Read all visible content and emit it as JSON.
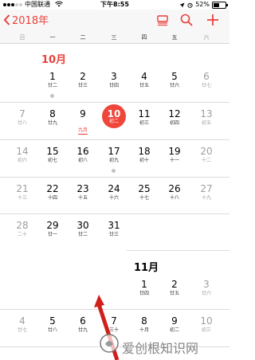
{
  "status_bar": {
    "carrier": "中国联通",
    "time": "下午8:55",
    "battery": "52%",
    "battery_level": 0.52
  },
  "nav": {
    "back_label": "2018年",
    "icons": [
      "chevron-left-icon",
      "list-view-icon",
      "search-icon",
      "add-icon"
    ]
  },
  "weekdays": [
    "日",
    "一",
    "二",
    "三",
    "四",
    "五",
    "六"
  ],
  "months": {
    "oct_label": "10月",
    "nov_label": "11月"
  },
  "october": [
    {
      "day": "1",
      "lunar": "廿二",
      "dot": true
    },
    {
      "day": "2",
      "lunar": "廿三"
    },
    {
      "day": "3",
      "lunar": "廿四"
    },
    {
      "day": "4",
      "lunar": "廿五"
    },
    {
      "day": "5",
      "lunar": "廿六"
    },
    {
      "day": "6",
      "lunar": "廿七"
    },
    {
      "day": "7",
      "lunar": "廿八"
    },
    {
      "day": "8",
      "lunar": "廿九"
    },
    {
      "day": "9",
      "lunar": "九月"
    },
    {
      "day": "10",
      "lunar": "初二",
      "today": true
    },
    {
      "day": "11",
      "lunar": "初三"
    },
    {
      "day": "12",
      "lunar": "初四"
    },
    {
      "day": "13",
      "lunar": "初五"
    },
    {
      "day": "14",
      "lunar": "初六"
    },
    {
      "day": "15",
      "lunar": "初七"
    },
    {
      "day": "16",
      "lunar": "初八"
    },
    {
      "day": "17",
      "lunar": "初九",
      "dot": true
    },
    {
      "day": "18",
      "lunar": "初十"
    },
    {
      "day": "19",
      "lunar": "十一"
    },
    {
      "day": "20",
      "lunar": "十二"
    },
    {
      "day": "21",
      "lunar": "十三"
    },
    {
      "day": "22",
      "lunar": "十四"
    },
    {
      "day": "23",
      "lunar": "十五"
    },
    {
      "day": "24",
      "lunar": "十六"
    },
    {
      "day": "25",
      "lunar": "十七"
    },
    {
      "day": "26",
      "lunar": "十八"
    },
    {
      "day": "27",
      "lunar": "十九"
    },
    {
      "day": "28",
      "lunar": "二十"
    },
    {
      "day": "29",
      "lunar": "廿一"
    },
    {
      "day": "30",
      "lunar": "廿二"
    },
    {
      "day": "31",
      "lunar": "廿三"
    }
  ],
  "november": [
    {
      "day": "1",
      "lunar": "廿四"
    },
    {
      "day": "2",
      "lunar": "廿五"
    },
    {
      "day": "3",
      "lunar": "廿六"
    },
    {
      "day": "4",
      "lunar": "廿七"
    },
    {
      "day": "5",
      "lunar": "廿八"
    },
    {
      "day": "6",
      "lunar": "廿九"
    },
    {
      "day": "7",
      "lunar": "三十"
    },
    {
      "day": "8",
      "lunar": "十月"
    },
    {
      "day": "9",
      "lunar": "初二"
    },
    {
      "day": "10",
      "lunar": "初三"
    }
  ],
  "watermark": "爱创根知识网",
  "colors": {
    "accent": "#e8413c",
    "today": "#f0453a"
  }
}
